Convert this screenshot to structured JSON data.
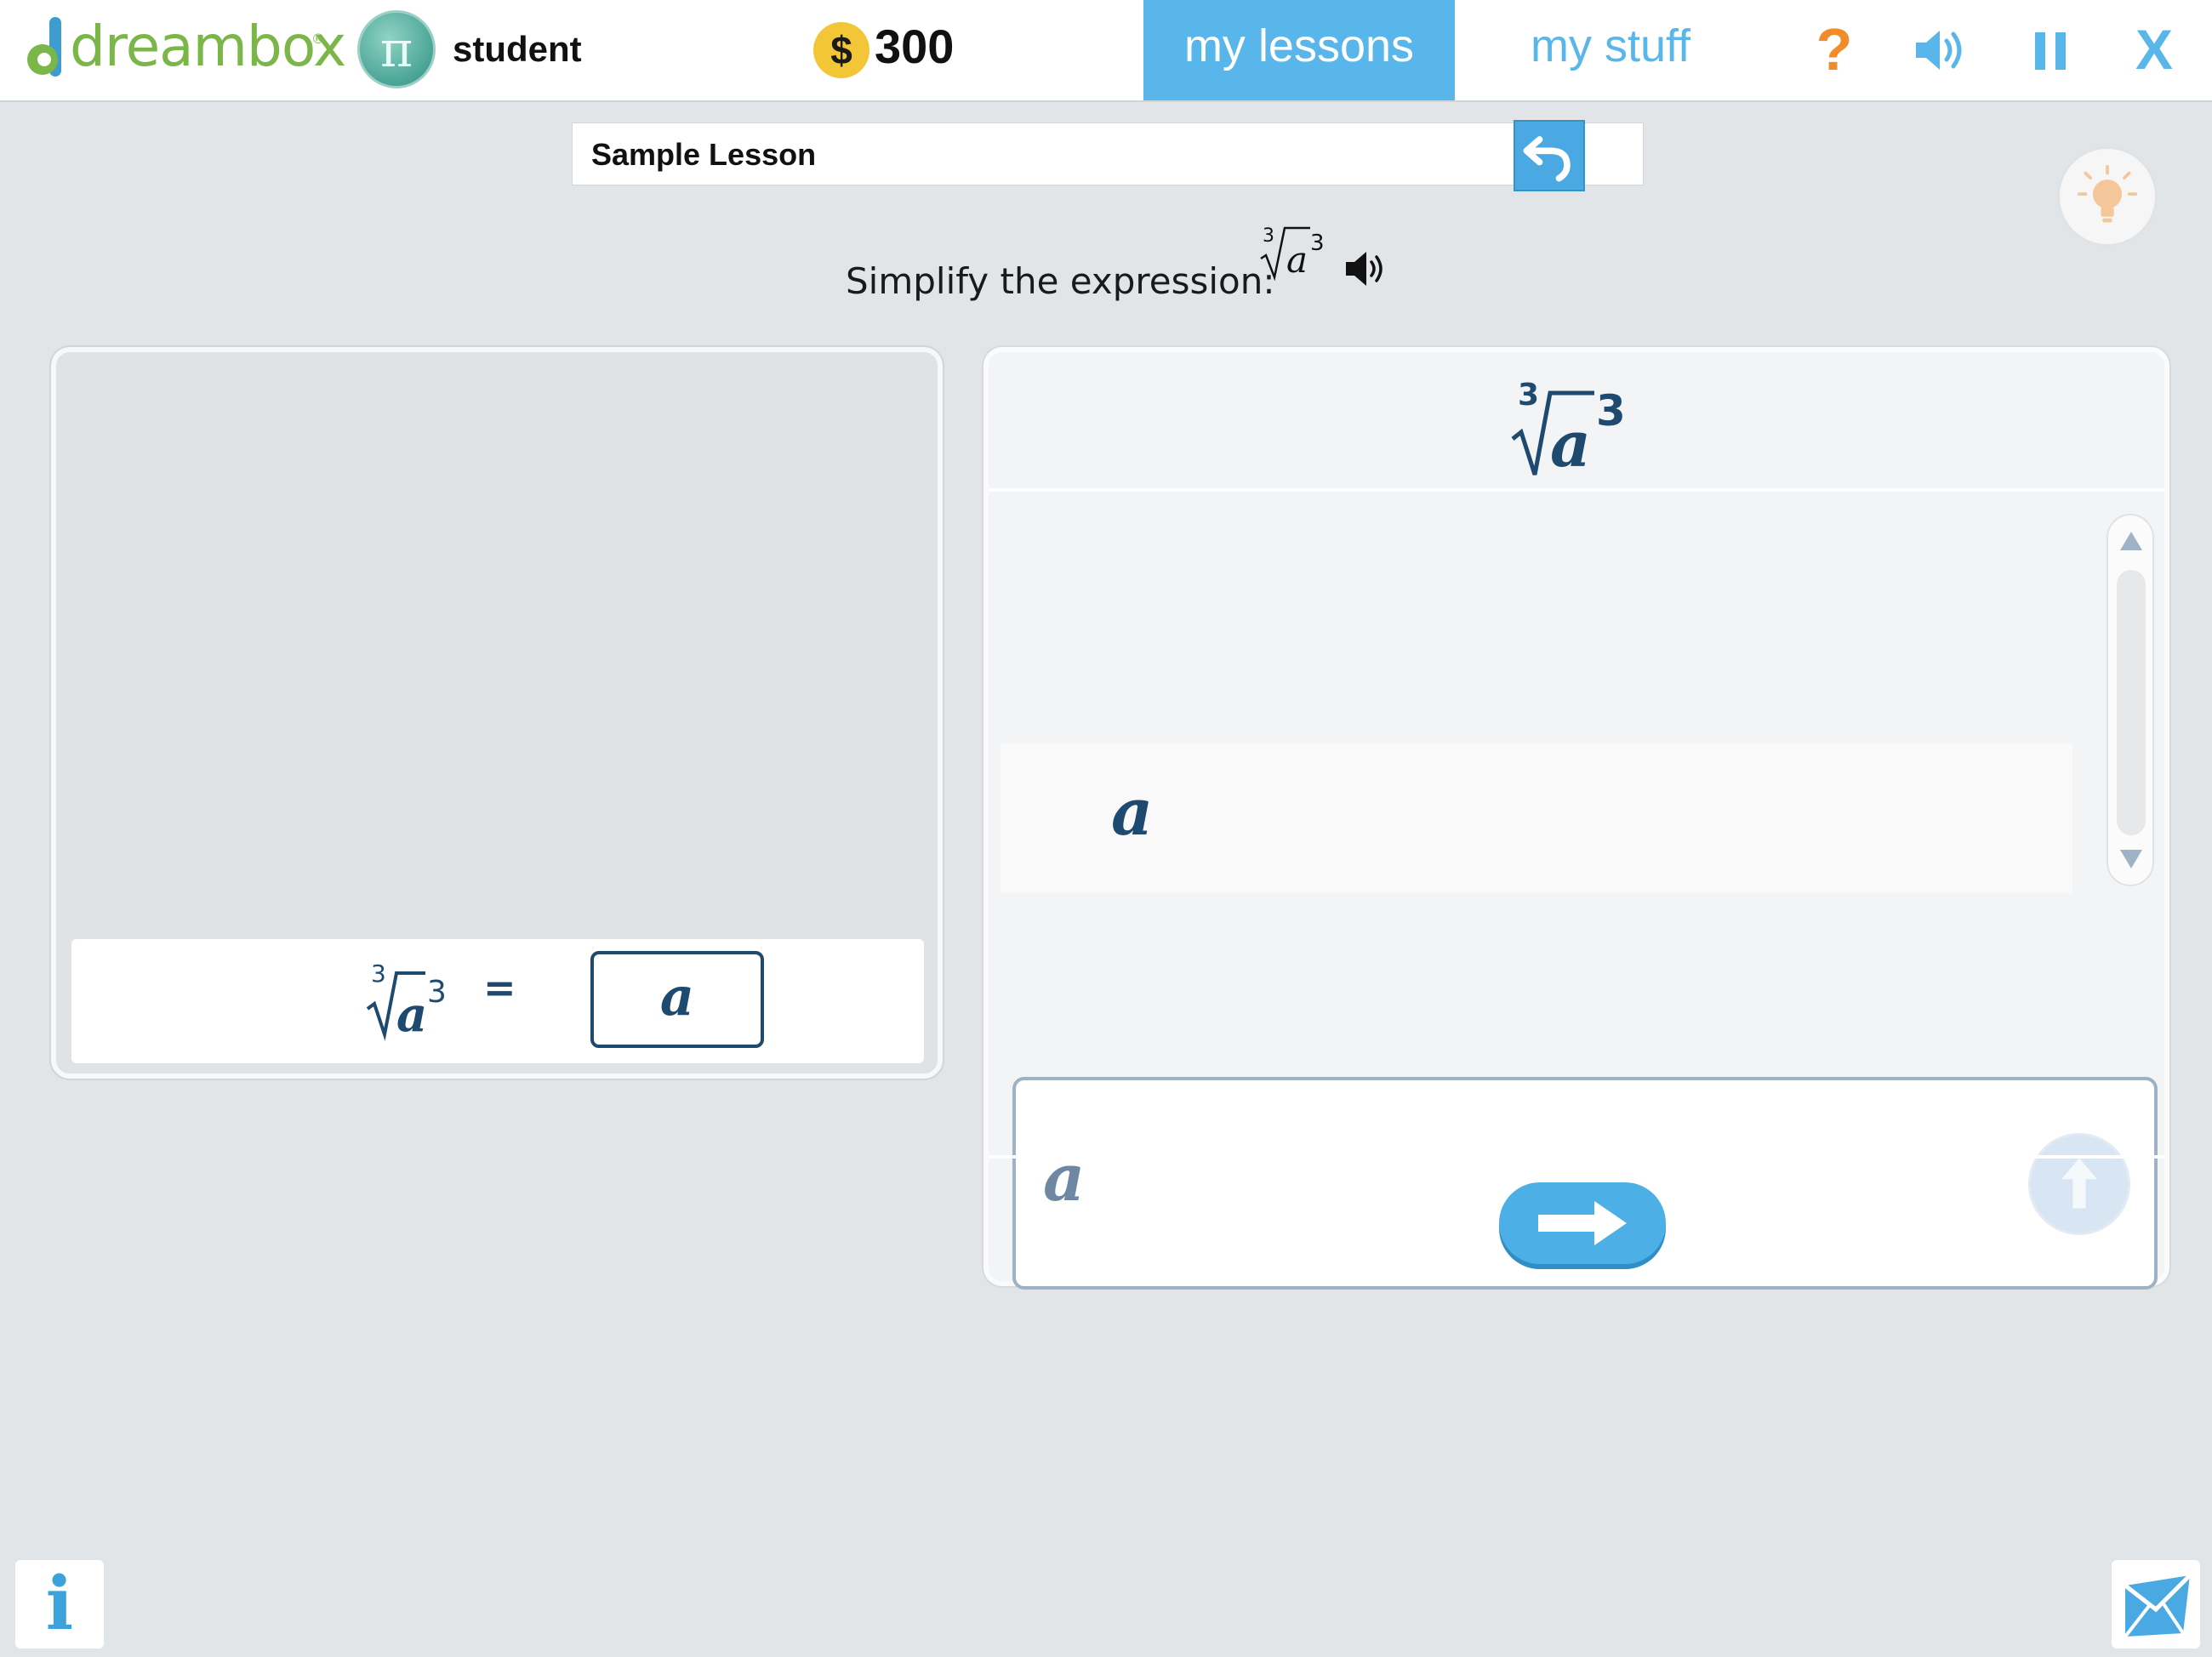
{
  "header": {
    "logo_text": "dreambox",
    "logo_reg": "®",
    "avatar_symbol": "π",
    "username": "student",
    "coin_symbol": "$",
    "coins": "300",
    "tabs": [
      {
        "label": "my lessons",
        "active": true
      },
      {
        "label": "my stuff",
        "active": false
      }
    ],
    "help_label": "?",
    "close_label": "X",
    "icons": [
      "logo-icon",
      "avatar-icon",
      "coin-icon",
      "sound-icon",
      "pause-icon"
    ]
  },
  "lesson": {
    "title": "Sample Lesson",
    "icons": [
      "back-arrow-icon",
      "lightbulb-hint-icon"
    ]
  },
  "prompt": {
    "text": "Simplify the expression:",
    "expression": {
      "index": "3",
      "base": "a",
      "exponent": "3"
    },
    "icon": "audio-speaker-icon"
  },
  "left_panel": {
    "equation": {
      "lhs": {
        "index": "3",
        "base": "a",
        "exponent": "3"
      },
      "sign": "=",
      "answer": "a"
    }
  },
  "right_panel": {
    "expression": {
      "index": "3",
      "base": "a",
      "exponent": "3"
    },
    "history": [
      "a"
    ],
    "input_value": "a",
    "icons": [
      "scroll-up-icon",
      "scroll-down-icon",
      "submit-up-arrow-icon",
      "next-arrow-icon"
    ]
  },
  "footer": {
    "info_label": "i",
    "icons": [
      "info-icon",
      "mail-icon"
    ]
  },
  "colors": {
    "brand_green": "#7ab648",
    "accent_blue": "#59b6ea",
    "help_orange": "#f08c2a",
    "math_navy": "#1f4a70",
    "background": "#e2e5e8"
  }
}
